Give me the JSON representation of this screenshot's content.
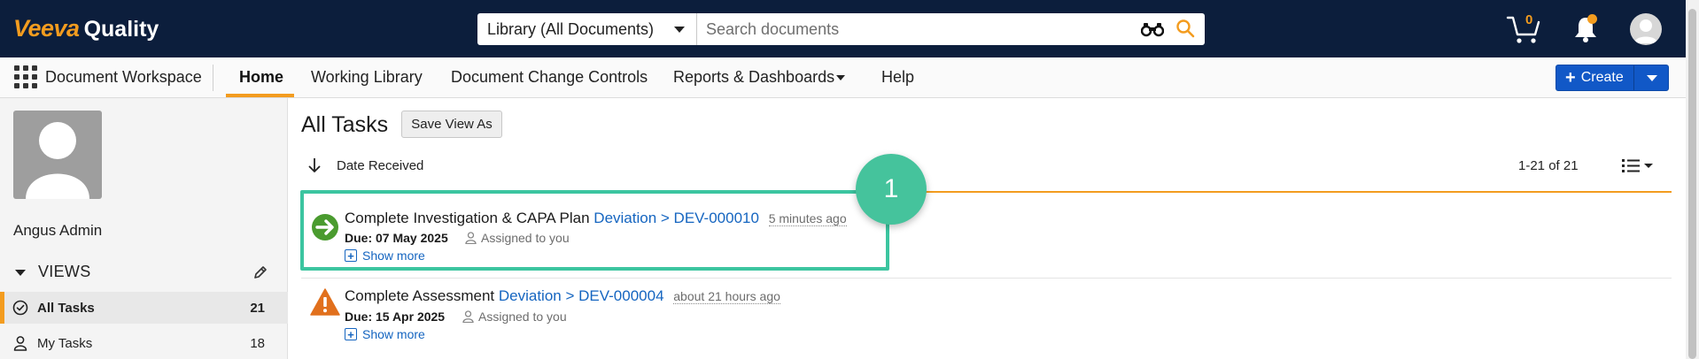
{
  "app": {
    "brand": "Veeva",
    "product": "Quality"
  },
  "search": {
    "scope": "Library (All Documents)",
    "placeholder": "Search documents"
  },
  "header_icons": {
    "cart_count": "0",
    "cart_icon": "cart-icon",
    "bell_icon": "bell-icon",
    "avatar_icon": "user-avatar-icon",
    "accent": "#f39c1f",
    "bar_color": "#0c1e3c"
  },
  "nav": {
    "workspace": "Document Workspace",
    "tabs": [
      {
        "label": "Home",
        "active": true
      },
      {
        "label": "Working Library"
      },
      {
        "label": "Document Change Controls"
      },
      {
        "label": "Reports & Dashboards"
      },
      {
        "label": "Help"
      }
    ],
    "create_label": "Create"
  },
  "sidebar": {
    "user_name": "Angus Admin",
    "views_label": "VIEWS",
    "items": [
      {
        "label": "All Tasks",
        "count": "21",
        "active": true,
        "icon": "check-circle-icon"
      },
      {
        "label": "My Tasks",
        "count": "18",
        "icon": "person-icon"
      }
    ]
  },
  "main": {
    "title": "All Tasks",
    "save_view_label": "Save View As",
    "sort_label": "Date Received",
    "count_label": "1-21 of 21",
    "tasks": [
      {
        "title": "Complete Investigation & CAPA Plan",
        "link": "Deviation > DEV-000010",
        "ago": "5 minutes ago",
        "due": "Due: 07 May 2025",
        "assigned": "Assigned to you",
        "more": "Show more",
        "status_icon": "arrow-right-circle-icon",
        "status_color": "#4a9b2f"
      },
      {
        "title": "Complete Assessment",
        "link": "Deviation > DEV-000004",
        "ago": "about 21 hours ago",
        "due": "Due: 15 Apr 2025",
        "assigned": "Assigned to you",
        "more": "Show more",
        "status_icon": "warning-triangle-icon",
        "status_color": "#e1701d"
      }
    ]
  },
  "callout": {
    "number": "1",
    "color": "#3cc5a0"
  }
}
